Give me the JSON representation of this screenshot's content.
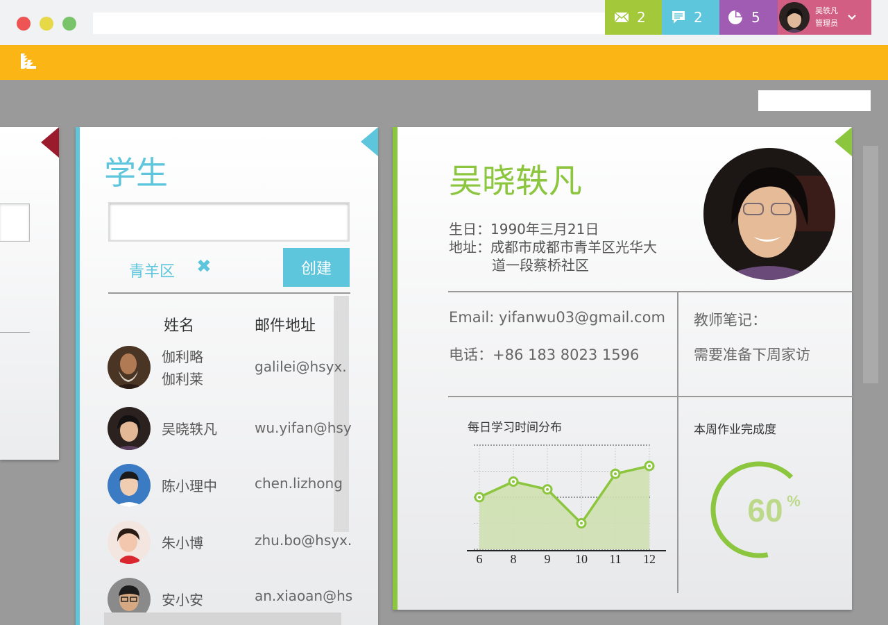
{
  "header": {
    "mail_count": "2",
    "chat_count": "2",
    "pie_count": "5",
    "user_name": "吴轶凡",
    "user_role": "管理员"
  },
  "students": {
    "title": "学生",
    "filter_tag": "青羊区",
    "clear_symbol": "✖",
    "create_label": "创建",
    "col_name": "姓名",
    "col_email": "邮件地址",
    "rows": [
      {
        "name_line1": "伽利略",
        "name_line2": "伽利莱",
        "email": "galilei@hsyx."
      },
      {
        "name": "吴晓轶凡",
        "email": "wu.yifan@hsy"
      },
      {
        "name": "陈小理中",
        "email": "chen.lizhong"
      },
      {
        "name": "朱小博",
        "email": "zhu.bo@hsyx."
      },
      {
        "name": "安小安",
        "email": "an.xiaoan@hs"
      }
    ]
  },
  "profile": {
    "name": "吴晓轶凡",
    "birthday_label": "生日：",
    "birthday": "1990年三月21日",
    "address_label": "地址：",
    "address_line1": "成都市成都市青羊区光华大",
    "address_line2": "道一段蔡桥社区",
    "email_label": "Email: ",
    "email": "yifanwu03@gmail.com",
    "phone_label": "电话：",
    "phone": "+86 183 8023 1596",
    "notes_label": "教师笔记：",
    "notes": "需要准备下周家访",
    "study_chart_title": "每日学习时间分布",
    "completion_title": "本周作业完成度",
    "completion_value": "60",
    "completion_unit": "%",
    "completion_fraction": 0.6
  },
  "chart_data": {
    "type": "area",
    "title": "每日学习时间分布",
    "categories": [
      "6",
      "8",
      "9",
      "10",
      "11",
      "12"
    ],
    "values": [
      2.0,
      2.6,
      2.3,
      1.0,
      2.9,
      3.2
    ],
    "ylim": [
      0,
      4
    ],
    "grid": true
  },
  "colors": {
    "accent_yellow": "#fbb616",
    "accent_green": "#8cc63f",
    "accent_cyan": "#5ec6dc",
    "accent_purple": "#a05cb2",
    "accent_pink": "#d25e83",
    "accent_red": "#9a1b2b"
  },
  "icons": [
    "logo-icon",
    "mail-icon",
    "chat-icon",
    "pie-chart-icon",
    "chevron-down-icon",
    "close-icon"
  ]
}
